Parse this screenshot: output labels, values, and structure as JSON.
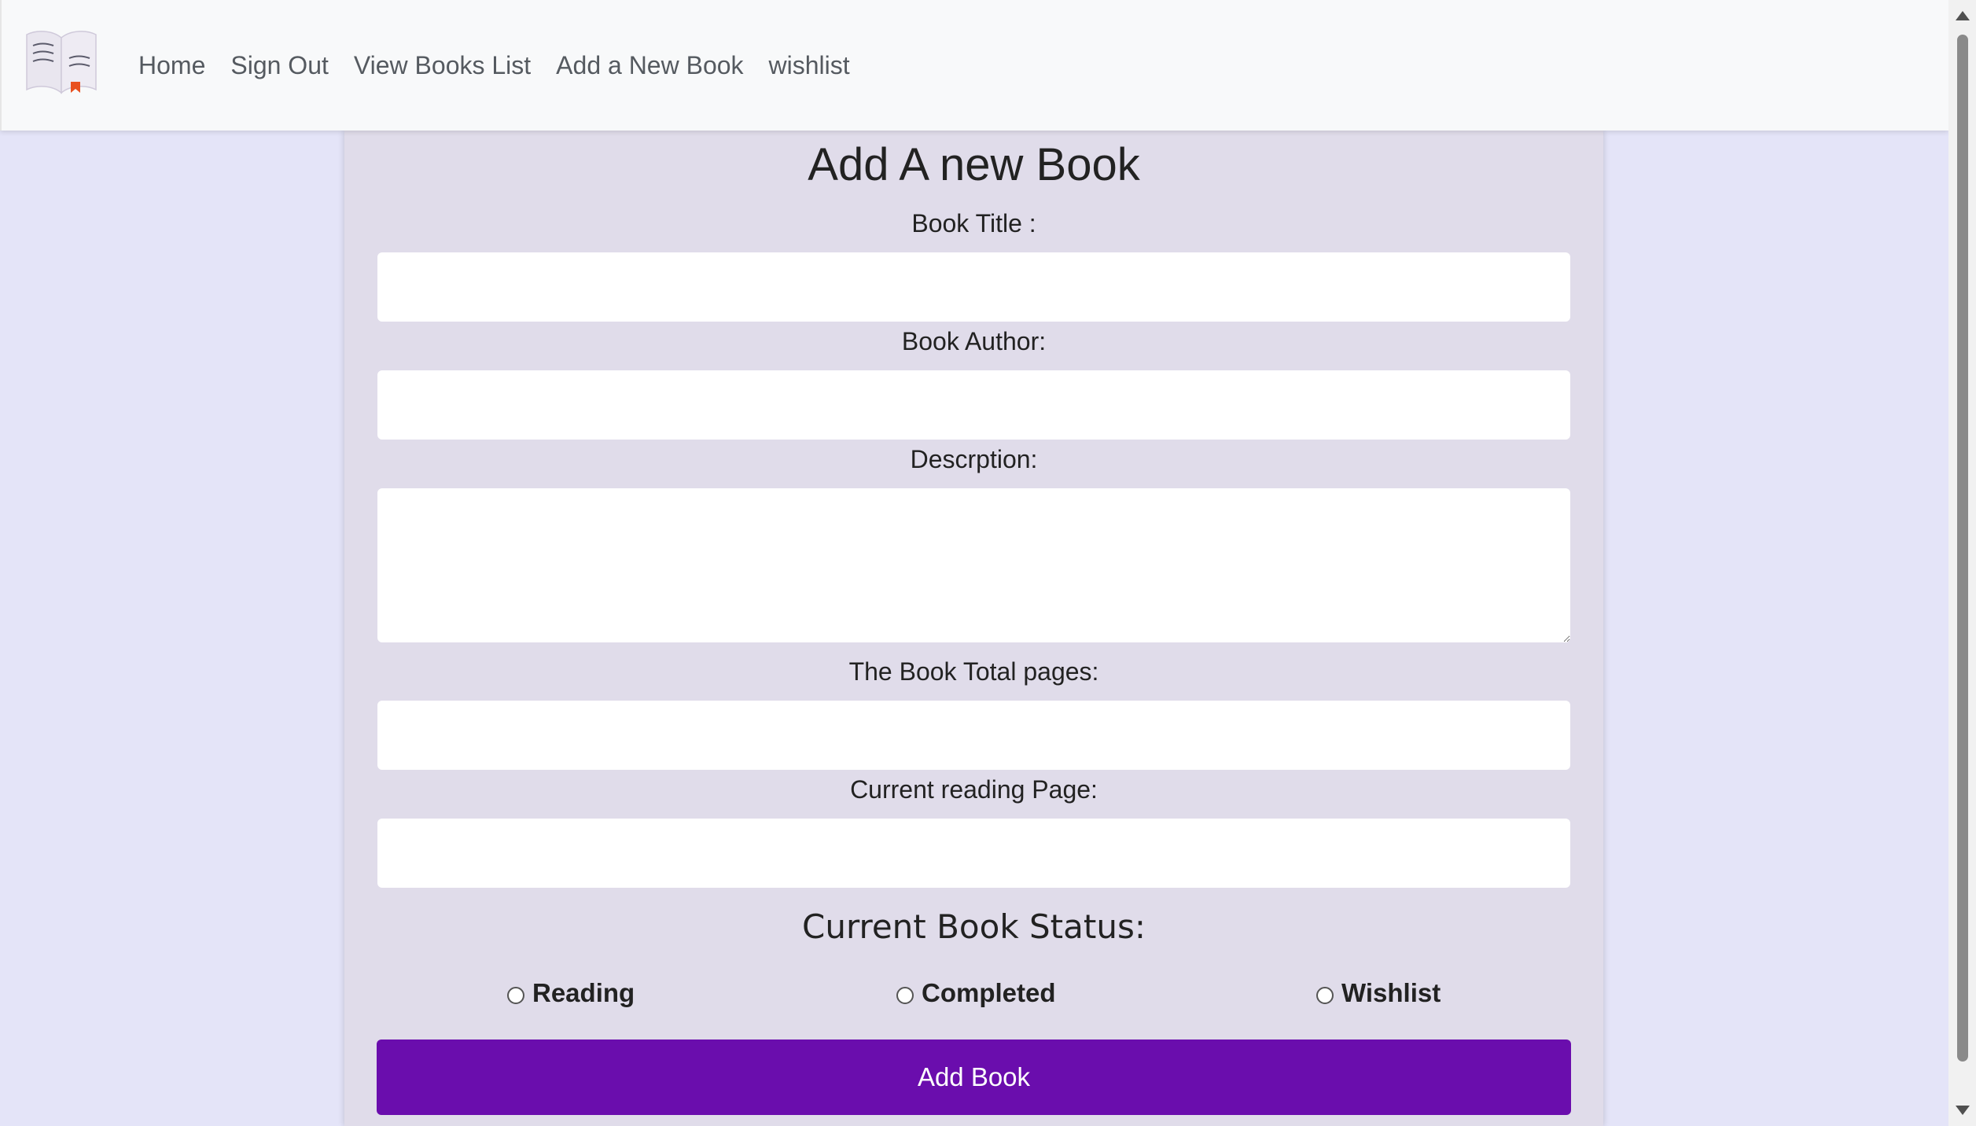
{
  "navbar": {
    "logo_icon": "open-book-icon",
    "links": [
      {
        "label": "Home"
      },
      {
        "label": "Sign Out"
      },
      {
        "label": "View Books List"
      },
      {
        "label": "Add a New Book"
      },
      {
        "label": "wishlist"
      }
    ]
  },
  "form": {
    "title": "Add A new Book",
    "book_title": {
      "label": "Book Title :",
      "value": ""
    },
    "book_author": {
      "label": "Book Author:",
      "value": ""
    },
    "description": {
      "label": "Descrption:",
      "value": ""
    },
    "total_pages": {
      "label": "The Book Total pages:",
      "value": ""
    },
    "current_page": {
      "label": "Current reading Page:",
      "value": ""
    },
    "status_heading": "Current Book Status:",
    "status_options": [
      {
        "label": "Reading",
        "checked": false
      },
      {
        "label": "Completed",
        "checked": false
      },
      {
        "label": "Wishlist",
        "checked": false
      }
    ],
    "submit_label": "Add Book"
  },
  "colors": {
    "accent": "#6a0dad",
    "page_background": "#e4e4f8",
    "card_background": "#e0dcea",
    "navbar_background": "#f8f9fa"
  }
}
